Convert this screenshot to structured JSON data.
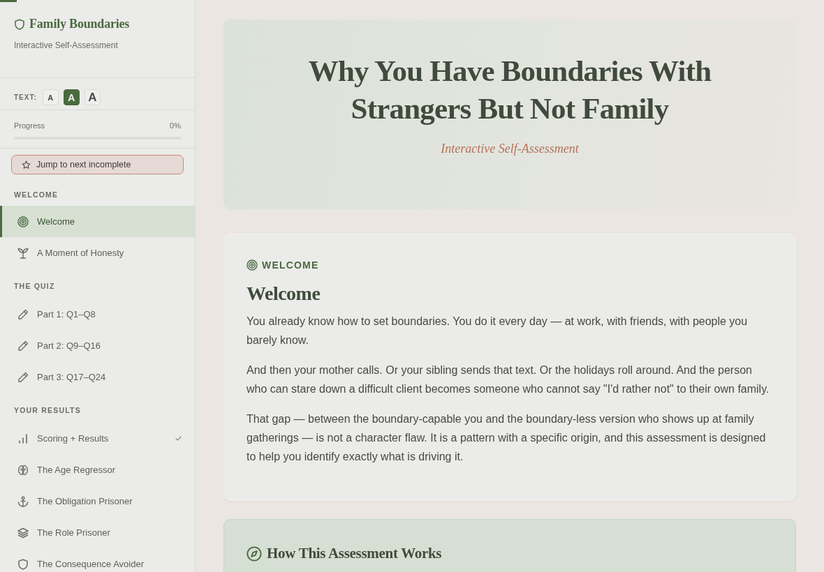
{
  "reading_progress": {
    "level": 0.02
  },
  "sidebar": {
    "brand": {
      "title": "Family Boundaries",
      "subtitle": "Interactive Self-Assessment"
    },
    "text_size": {
      "label": "TEXT:",
      "options": [
        {
          "label": "A",
          "selected": false
        },
        {
          "label": "A",
          "selected": true
        },
        {
          "label": "A",
          "selected": false
        }
      ]
    },
    "progress": {
      "label": "Progress",
      "value": "0%",
      "level": 0
    },
    "jump_button": {
      "label": "Jump to next incomplete"
    },
    "sections": [
      {
        "title": "WELCOME",
        "items": [
          {
            "label": "Welcome",
            "selected": true,
            "done": false
          },
          {
            "label": "A Moment of Honesty",
            "selected": false,
            "done": false
          }
        ]
      },
      {
        "title": "THE QUIZ",
        "items": [
          {
            "label": "Part 1: Q1–Q8",
            "selected": false,
            "done": false
          },
          {
            "label": "Part 2: Q9–Q16",
            "selected": false,
            "done": false
          },
          {
            "label": "Part 3: Q17–Q24",
            "selected": false,
            "done": false
          }
        ]
      },
      {
        "title": "YOUR RESULTS",
        "items": [
          {
            "label": "Scoring + Results",
            "selected": false,
            "done": true
          },
          {
            "label": "The Age Regressor",
            "selected": false,
            "done": false
          },
          {
            "label": "The Obligation Prisoner",
            "selected": false,
            "done": false
          },
          {
            "label": "The Role Prisoner",
            "selected": false,
            "done": false
          },
          {
            "label": "The Consequence Avoider",
            "selected": false,
            "done": false
          }
        ]
      }
    ]
  },
  "hero": {
    "title": "Why You Have Boundaries With Strangers But Not Family",
    "subtitle": "Interactive Self-Assessment"
  },
  "cards": [
    {
      "kind": "section",
      "kicker": "WELCOME",
      "title": "Welcome",
      "paragraphs": [
        "You already know how to set boundaries. You do it every day — at work, with friends, with people you barely know.",
        "And then your mother calls. Or your sibling sends that text. Or the holidays roll around. And the person who can stare down a difficult client becomes someone who cannot say \"I'd rather not\" to their own family.",
        "That gap — between the boundary-capable you and the boundary-less version who shows up at family gatherings — is not a character flaw. It is a pattern with a specific origin, and this assessment is designed to help you identify exactly what is driving it."
      ]
    },
    {
      "kind": "highlight",
      "title": "How This Assessment Works"
    }
  ]
}
